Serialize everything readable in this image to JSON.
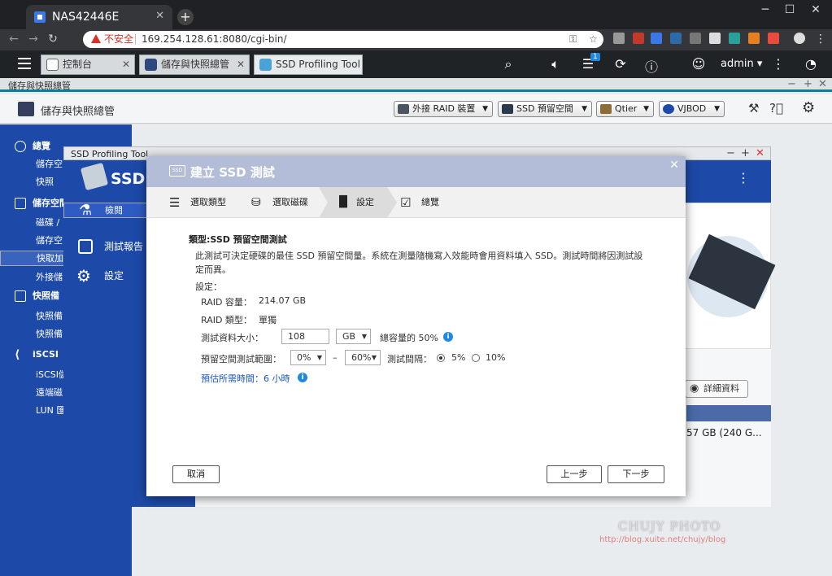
{
  "browser": {
    "tab_title": "NAS42446E",
    "new_tab": "+",
    "not_secure": "不安全",
    "url": "169.254.128.61:8080/cgi-bin/",
    "win_min": "─",
    "win_max": "☐",
    "win_close": "✕"
  },
  "qts": {
    "tabs": [
      {
        "label": "控制台"
      },
      {
        "label": "儲存與快照總管"
      },
      {
        "label": "SSD Profiling Tool"
      }
    ],
    "notif_count": "1",
    "user": "admin ▾"
  },
  "storage_app": {
    "bar_title": "儲存與快照總管",
    "title": "儲存與快照總管",
    "buttons": [
      "外接 RAID 裝置",
      "SSD 預留空間",
      "Qtier",
      "VJBOD"
    ],
    "nav": [
      {
        "label": "總覽",
        "head": true
      },
      {
        "label": "儲存空",
        "head": false
      },
      {
        "label": "快照",
        "head": false
      },
      {
        "label": "儲存空間",
        "head": true
      },
      {
        "label": "磁碟 /",
        "head": false
      },
      {
        "label": "儲存空",
        "head": false
      },
      {
        "label": "快取加",
        "head": false,
        "selected": true
      },
      {
        "label": "外接儲",
        "head": false
      },
      {
        "label": "快照備",
        "head": true
      },
      {
        "label": "快照備",
        "head": false
      },
      {
        "label": "快照備",
        "head": false
      },
      {
        "label": "iSCSI",
        "head": true
      },
      {
        "label": "iSCSI儲",
        "head": false
      },
      {
        "label": "遠端磁",
        "head": false
      },
      {
        "label": "LUN 匯",
        "head": false
      }
    ]
  },
  "ssd_tool": {
    "window_title": "SSD Profiling Tool",
    "header": "SSD 分",
    "nav": [
      {
        "label": "檢閱"
      },
      {
        "label": "測試報告"
      },
      {
        "label": "設定"
      }
    ],
    "detail_button": "詳細資料",
    "bg_size": "57 GB (240 G..."
  },
  "modal": {
    "title": "建立 SSD 測試",
    "steps": [
      "選取類型",
      "選取磁碟",
      "設定",
      "總覽"
    ],
    "type_label": "類型:SSD 預留空間測試",
    "description": "此測試可決定硬碟的最佳 SSD 預留空間量。系統在測量隨機寫入效能時會用資料填入 SSD。測試時間將因測試設定而異。",
    "settings_label": "設定：",
    "raid_capacity_label": "RAID 容量：",
    "raid_capacity_value": "214.07 GB",
    "raid_type_label": "RAID 類型：",
    "raid_type_value": "單獨",
    "test_size_label": "測試資料大小：",
    "test_size_value": "108",
    "test_size_unit": "GB",
    "test_size_pct": "總容量的 50%",
    "range_label": "預留空間測試範圍：",
    "range_from": "0%",
    "range_dash": "–",
    "range_to": "60%",
    "interval_label": "測試間隔：",
    "interval_options": [
      "5%",
      "10%"
    ],
    "interval_selected": "5%",
    "estimated_time": "預估所需時間：6 小時",
    "cancel": "取消",
    "prev": "上一步",
    "next": "下一步"
  },
  "watermark": {
    "line1": "CHUJY PHOTO",
    "line2": "http://blog.xuite.net/chujy/blog"
  },
  "colors": {
    "nav_blue": "#1d4aa8",
    "modal_header": "#b3bdd7",
    "info_blue": "#1e88e5",
    "accent_teal": "#0a7f9c"
  }
}
